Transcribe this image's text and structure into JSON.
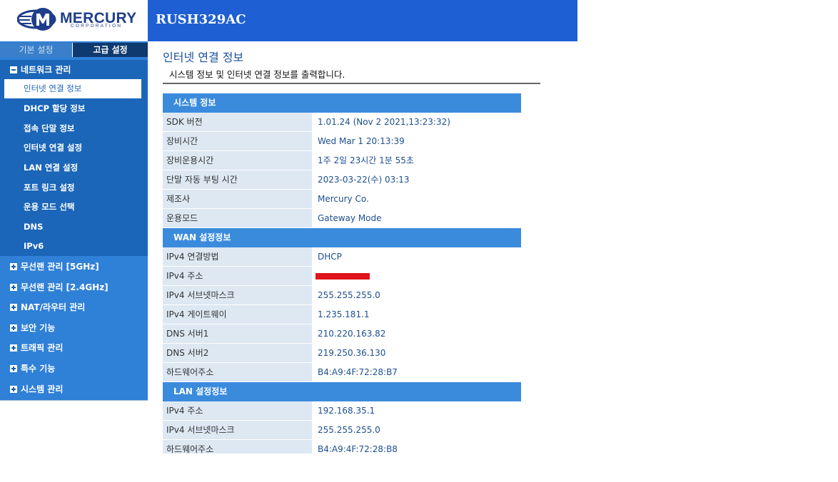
{
  "brand": {
    "name": "MERCURY",
    "sub": "CORPORATION"
  },
  "header": {
    "model": "RUSH329AC"
  },
  "sidebar": {
    "tabs": [
      {
        "label": "기본 설정",
        "active": false
      },
      {
        "label": "고급 설정",
        "active": true
      }
    ],
    "expanded_group": {
      "label": "네트워크 관리",
      "items": [
        {
          "label": "인터넷 연결 정보",
          "active": true
        },
        {
          "label": "DHCP 할당 정보"
        },
        {
          "label": "접속 단말 정보"
        },
        {
          "label": "인터넷 연결 설정"
        },
        {
          "label": "LAN 연결 설정"
        },
        {
          "label": "포트 링크 설정"
        },
        {
          "label": "운용 모드 선택"
        },
        {
          "label": "DNS"
        },
        {
          "label": "IPv6"
        }
      ]
    },
    "groups": [
      {
        "label": "무선랜 관리 [5GHz]"
      },
      {
        "label": "무선랜 관리 [2.4GHz]"
      },
      {
        "label": "NAT/라우터 관리"
      },
      {
        "label": "보안 기능"
      },
      {
        "label": "트래픽 관리"
      },
      {
        "label": "특수 기능"
      },
      {
        "label": "시스템 관리"
      }
    ]
  },
  "main": {
    "title": "인터넷 연결 정보",
    "description": "시스템 정보 및 인터넷 연결 정보를 출력합니다.",
    "sections": [
      {
        "header": "시스템 정보",
        "rows": [
          {
            "label": "SDK 버전",
            "value": "1.01.24 (Nov 2 2021,13:23:32)"
          },
          {
            "label": "장비시간",
            "value": "Wed Mar 1 20:13:39"
          },
          {
            "label": "장비운용시간",
            "value": "1주 2일 23시간 1분 55초"
          },
          {
            "label": "단말 자동 부팅 시간",
            "value": "2023-03-22(수) 03:13"
          },
          {
            "label": "제조사",
            "value": "Mercury Co."
          },
          {
            "label": "운용모드",
            "value": "Gateway Mode"
          }
        ]
      },
      {
        "header": "WAN 설정정보",
        "rows": [
          {
            "label": "IPv4 연결방법",
            "value": "DHCP"
          },
          {
            "label": "IPv4 주소",
            "value": "",
            "redacted": true
          },
          {
            "label": "IPv4 서브넷마스크",
            "value": "255.255.255.0"
          },
          {
            "label": "IPv4 게이트웨이",
            "value": "1.235.181.1"
          },
          {
            "label": "DNS 서버1",
            "value": "210.220.163.82"
          },
          {
            "label": "DNS 서버2",
            "value": "219.250.36.130"
          },
          {
            "label": "하드웨어주소",
            "value": "B4:A9:4F:72:28:B7"
          }
        ]
      },
      {
        "header": "LAN 설정정보",
        "rows": [
          {
            "label": "IPv4 주소",
            "value": "192.168.35.1"
          },
          {
            "label": "IPv4 서브넷마스크",
            "value": "255.255.255.0"
          },
          {
            "label": "하드웨어주소",
            "value": "B4:A9:4F:72:28:B8"
          }
        ]
      }
    ]
  },
  "colors": {
    "header_blue": "#1e5fd4",
    "sidebar_blue": "#2f80d7",
    "section_header": "#3b8bdd",
    "redaction": "#e1131b"
  }
}
